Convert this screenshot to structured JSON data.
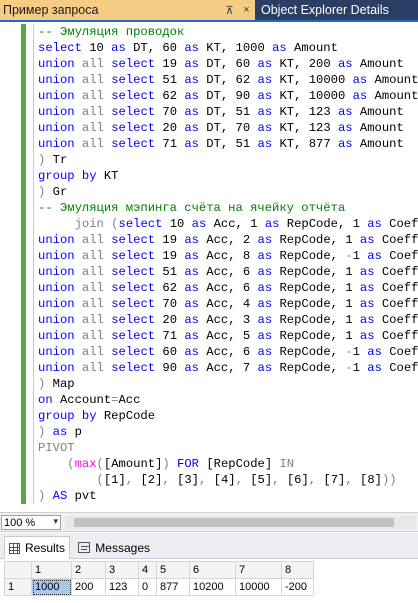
{
  "tabs": {
    "active_label": "Пример запроса",
    "pin_glyph": "⊼",
    "close_glyph": "×",
    "inactive_label": "Object Explorer Details"
  },
  "editor": {
    "lines": [
      [
        [
          "c",
          "-- Эмуляция проводок"
        ]
      ],
      [
        [
          "k",
          "select"
        ],
        [
          "t",
          " 10 "
        ],
        [
          "k",
          "as"
        ],
        [
          "t",
          " DT, 60 "
        ],
        [
          "k",
          "as"
        ],
        [
          "t",
          " KT, 1000 "
        ],
        [
          "k",
          "as"
        ],
        [
          "t",
          " Amount"
        ]
      ],
      [
        [
          "k",
          "union"
        ],
        [
          "t",
          " "
        ],
        [
          "g",
          "all"
        ],
        [
          "t",
          " "
        ],
        [
          "k",
          "select"
        ],
        [
          "t",
          " 19 "
        ],
        [
          "k",
          "as"
        ],
        [
          "t",
          " DT, 60 "
        ],
        [
          "k",
          "as"
        ],
        [
          "t",
          " KT, 200 "
        ],
        [
          "k",
          "as"
        ],
        [
          "t",
          " Amount"
        ]
      ],
      [
        [
          "k",
          "union"
        ],
        [
          "t",
          " "
        ],
        [
          "g",
          "all"
        ],
        [
          "t",
          " "
        ],
        [
          "k",
          "select"
        ],
        [
          "t",
          " 51 "
        ],
        [
          "k",
          "as"
        ],
        [
          "t",
          " DT, 62 "
        ],
        [
          "k",
          "as"
        ],
        [
          "t",
          " KT, 10000 "
        ],
        [
          "k",
          "as"
        ],
        [
          "t",
          " Amount"
        ]
      ],
      [
        [
          "k",
          "union"
        ],
        [
          "t",
          " "
        ],
        [
          "g",
          "all"
        ],
        [
          "t",
          " "
        ],
        [
          "k",
          "select"
        ],
        [
          "t",
          " 62 "
        ],
        [
          "k",
          "as"
        ],
        [
          "t",
          " DT, 90 "
        ],
        [
          "k",
          "as"
        ],
        [
          "t",
          " KT, 10000 "
        ],
        [
          "k",
          "as"
        ],
        [
          "t",
          " Amount"
        ]
      ],
      [
        [
          "k",
          "union"
        ],
        [
          "t",
          " "
        ],
        [
          "g",
          "all"
        ],
        [
          "t",
          " "
        ],
        [
          "k",
          "select"
        ],
        [
          "t",
          " 70 "
        ],
        [
          "k",
          "as"
        ],
        [
          "t",
          " DT, 51 "
        ],
        [
          "k",
          "as"
        ],
        [
          "t",
          " KT, 123 "
        ],
        [
          "k",
          "as"
        ],
        [
          "t",
          " Amount"
        ]
      ],
      [
        [
          "k",
          "union"
        ],
        [
          "t",
          " "
        ],
        [
          "g",
          "all"
        ],
        [
          "t",
          " "
        ],
        [
          "k",
          "select"
        ],
        [
          "t",
          " 20 "
        ],
        [
          "k",
          "as"
        ],
        [
          "t",
          " DT, 70 "
        ],
        [
          "k",
          "as"
        ],
        [
          "t",
          " KT, 123 "
        ],
        [
          "k",
          "as"
        ],
        [
          "t",
          " Amount"
        ]
      ],
      [
        [
          "k",
          "union"
        ],
        [
          "t",
          " "
        ],
        [
          "g",
          "all"
        ],
        [
          "t",
          " "
        ],
        [
          "k",
          "select"
        ],
        [
          "t",
          " 71 "
        ],
        [
          "k",
          "as"
        ],
        [
          "t",
          " DT, 51 "
        ],
        [
          "k",
          "as"
        ],
        [
          "t",
          " KT, 877 "
        ],
        [
          "k",
          "as"
        ],
        [
          "t",
          " Amount"
        ]
      ],
      [
        [
          "g",
          ")"
        ],
        [
          "t",
          " Tr"
        ]
      ],
      [
        [
          "k",
          "group"
        ],
        [
          "t",
          " "
        ],
        [
          "k",
          "by"
        ],
        [
          "t",
          " KT"
        ]
      ],
      [
        [
          "g",
          ")"
        ],
        [
          "t",
          " Gr"
        ]
      ],
      [
        [
          "c",
          "-- Эмуляция мэпинга счёта на ячейку отчёта"
        ]
      ],
      [
        [
          "t",
          "     "
        ],
        [
          "g",
          "join"
        ],
        [
          "t",
          " "
        ],
        [
          "g",
          "("
        ],
        [
          "k",
          "select"
        ],
        [
          "t",
          " 10 "
        ],
        [
          "k",
          "as"
        ],
        [
          "t",
          " Acc, 1 "
        ],
        [
          "k",
          "as"
        ],
        [
          "t",
          " RepCode, 1 "
        ],
        [
          "k",
          "as"
        ],
        [
          "t",
          " Coeff"
        ]
      ],
      [
        [
          "k",
          "union"
        ],
        [
          "t",
          " "
        ],
        [
          "g",
          "all"
        ],
        [
          "t",
          " "
        ],
        [
          "k",
          "select"
        ],
        [
          "t",
          " 19 "
        ],
        [
          "k",
          "as"
        ],
        [
          "t",
          " Acc, 2 "
        ],
        [
          "k",
          "as"
        ],
        [
          "t",
          " RepCode, 1 "
        ],
        [
          "k",
          "as"
        ],
        [
          "t",
          " Coeff"
        ]
      ],
      [
        [
          "k",
          "union"
        ],
        [
          "t",
          " "
        ],
        [
          "g",
          "all"
        ],
        [
          "t",
          " "
        ],
        [
          "k",
          "select"
        ],
        [
          "t",
          " 19 "
        ],
        [
          "k",
          "as"
        ],
        [
          "t",
          " Acc, 8 "
        ],
        [
          "k",
          "as"
        ],
        [
          "t",
          " RepCode, "
        ],
        [
          "g",
          "-"
        ],
        [
          "t",
          "1 "
        ],
        [
          "k",
          "as"
        ],
        [
          "t",
          " Coeff"
        ]
      ],
      [
        [
          "k",
          "union"
        ],
        [
          "t",
          " "
        ],
        [
          "g",
          "all"
        ],
        [
          "t",
          " "
        ],
        [
          "k",
          "select"
        ],
        [
          "t",
          " 51 "
        ],
        [
          "k",
          "as"
        ],
        [
          "t",
          " Acc, 6 "
        ],
        [
          "k",
          "as"
        ],
        [
          "t",
          " RepCode, 1 "
        ],
        [
          "k",
          "as"
        ],
        [
          "t",
          " Coeff"
        ]
      ],
      [
        [
          "k",
          "union"
        ],
        [
          "t",
          " "
        ],
        [
          "g",
          "all"
        ],
        [
          "t",
          " "
        ],
        [
          "k",
          "select"
        ],
        [
          "t",
          " 62 "
        ],
        [
          "k",
          "as"
        ],
        [
          "t",
          " Acc, 6 "
        ],
        [
          "k",
          "as"
        ],
        [
          "t",
          " RepCode, 1 "
        ],
        [
          "k",
          "as"
        ],
        [
          "t",
          " Coeff"
        ]
      ],
      [
        [
          "k",
          "union"
        ],
        [
          "t",
          " "
        ],
        [
          "g",
          "all"
        ],
        [
          "t",
          " "
        ],
        [
          "k",
          "select"
        ],
        [
          "t",
          " 70 "
        ],
        [
          "k",
          "as"
        ],
        [
          "t",
          " Acc, 4 "
        ],
        [
          "k",
          "as"
        ],
        [
          "t",
          " RepCode, 1 "
        ],
        [
          "k",
          "as"
        ],
        [
          "t",
          " Coeff"
        ]
      ],
      [
        [
          "k",
          "union"
        ],
        [
          "t",
          " "
        ],
        [
          "g",
          "all"
        ],
        [
          "t",
          " "
        ],
        [
          "k",
          "select"
        ],
        [
          "t",
          " 20 "
        ],
        [
          "k",
          "as"
        ],
        [
          "t",
          " Acc, 3 "
        ],
        [
          "k",
          "as"
        ],
        [
          "t",
          " RepCode, 1 "
        ],
        [
          "k",
          "as"
        ],
        [
          "t",
          " Coeff"
        ]
      ],
      [
        [
          "k",
          "union"
        ],
        [
          "t",
          " "
        ],
        [
          "g",
          "all"
        ],
        [
          "t",
          " "
        ],
        [
          "k",
          "select"
        ],
        [
          "t",
          " 71 "
        ],
        [
          "k",
          "as"
        ],
        [
          "t",
          " Acc, 5 "
        ],
        [
          "k",
          "as"
        ],
        [
          "t",
          " RepCode, 1 "
        ],
        [
          "k",
          "as"
        ],
        [
          "t",
          " Coeff"
        ]
      ],
      [
        [
          "k",
          "union"
        ],
        [
          "t",
          " "
        ],
        [
          "g",
          "all"
        ],
        [
          "t",
          " "
        ],
        [
          "k",
          "select"
        ],
        [
          "t",
          " 60 "
        ],
        [
          "k",
          "as"
        ],
        [
          "t",
          " Acc, 6 "
        ],
        [
          "k",
          "as"
        ],
        [
          "t",
          " RepCode, "
        ],
        [
          "g",
          "-"
        ],
        [
          "t",
          "1 "
        ],
        [
          "k",
          "as"
        ],
        [
          "t",
          " Coeff"
        ]
      ],
      [
        [
          "k",
          "union"
        ],
        [
          "t",
          " "
        ],
        [
          "g",
          "all"
        ],
        [
          "t",
          " "
        ],
        [
          "k",
          "select"
        ],
        [
          "t",
          " 90 "
        ],
        [
          "k",
          "as"
        ],
        [
          "t",
          " Acc, 7 "
        ],
        [
          "k",
          "as"
        ],
        [
          "t",
          " RepCode, "
        ],
        [
          "g",
          "-"
        ],
        [
          "t",
          "1 "
        ],
        [
          "k",
          "as"
        ],
        [
          "t",
          " Coeff"
        ]
      ],
      [
        [
          "g",
          ")"
        ],
        [
          "t",
          " Map"
        ]
      ],
      [
        [
          "k",
          "on"
        ],
        [
          "t",
          " Account"
        ],
        [
          "g",
          "="
        ],
        [
          "t",
          "Acc"
        ]
      ],
      [
        [
          "k",
          "group"
        ],
        [
          "t",
          " "
        ],
        [
          "k",
          "by"
        ],
        [
          "t",
          " RepCode"
        ]
      ],
      [
        [
          "g",
          ")"
        ],
        [
          "t",
          " "
        ],
        [
          "k",
          "as"
        ],
        [
          "t",
          " p"
        ]
      ],
      [
        [
          "g",
          "PIVOT"
        ]
      ],
      [
        [
          "t",
          "    "
        ],
        [
          "g",
          "("
        ],
        [
          "m",
          "max"
        ],
        [
          "g",
          "("
        ],
        [
          "t",
          "[Amount]"
        ],
        [
          "g",
          ")"
        ],
        [
          "t",
          " "
        ],
        [
          "k",
          "FOR"
        ],
        [
          "t",
          " [RepCode] "
        ],
        [
          "g",
          "IN"
        ]
      ],
      [
        [
          "t",
          "        "
        ],
        [
          "g",
          "("
        ],
        [
          "t",
          "[1]"
        ],
        [
          "g",
          ","
        ],
        [
          "t",
          " [2]"
        ],
        [
          "g",
          ","
        ],
        [
          "t",
          " [3]"
        ],
        [
          "g",
          ","
        ],
        [
          "t",
          " [4]"
        ],
        [
          "g",
          ","
        ],
        [
          "t",
          " [5]"
        ],
        [
          "g",
          ","
        ],
        [
          "t",
          " [6]"
        ],
        [
          "g",
          ","
        ],
        [
          "t",
          " [7]"
        ],
        [
          "g",
          ","
        ],
        [
          "t",
          " [8]"
        ],
        [
          "g",
          "))"
        ]
      ],
      [
        [
          "g",
          ")"
        ],
        [
          "t",
          " "
        ],
        [
          "k",
          "AS"
        ],
        [
          "t",
          " pvt"
        ]
      ]
    ]
  },
  "zoom": {
    "value": "100 %",
    "arrow": "▾"
  },
  "results_tabs": {
    "results": "Results",
    "messages": "Messages"
  },
  "grid": {
    "headers": [
      "",
      "1",
      "2",
      "3",
      "4",
      "5",
      "6",
      "7",
      "8"
    ],
    "rows": [
      [
        "1",
        "1000",
        "200",
        "123",
        "0",
        "877",
        "10200",
        "10000",
        "-200"
      ]
    ]
  }
}
